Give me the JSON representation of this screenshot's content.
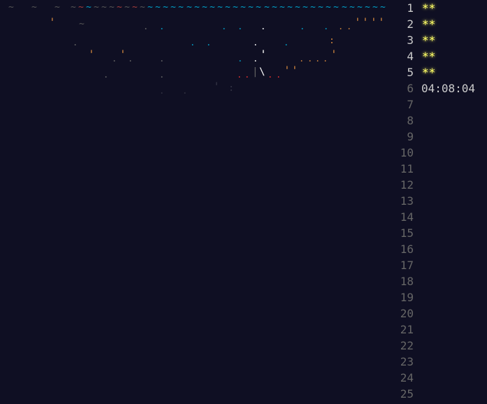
{
  "art": {
    "wave_row": "~  ~  ~ ~~~~~~~~~~~~~~~~~~~~~~~~~~~~~~~~~~~~~~~~~~~~~",
    "colors": {
      "background": "#0f0f23",
      "wave_dim": "#555555",
      "wave_red": "#a33c3c",
      "wave_cyan": "#00a0c8",
      "tree_cyan": "#00a0c8",
      "tree_gray": "#666666",
      "sand": "#c8803c",
      "red": "#e03030",
      "white": "#ffffff"
    },
    "icons": [
      "tilde-wave-icon",
      "dot-glyph-icon",
      "apostrophe-glyph-icon",
      "backslash-glyph-icon",
      "pipe-glyph-icon",
      "colon-glyph-icon"
    ]
  },
  "calendar": {
    "days": [
      {
        "label": "1",
        "stars": "**"
      },
      {
        "label": "2",
        "stars": "**"
      },
      {
        "label": "3",
        "stars": "**"
      },
      {
        "label": "4",
        "stars": "**"
      },
      {
        "label": "5",
        "stars": "**"
      },
      {
        "label": "6",
        "timer": "04:08:04"
      },
      {
        "label": "7"
      },
      {
        "label": "8"
      },
      {
        "label": "9"
      },
      {
        "label": "10"
      },
      {
        "label": "11"
      },
      {
        "label": "12"
      },
      {
        "label": "13"
      },
      {
        "label": "14"
      },
      {
        "label": "15"
      },
      {
        "label": "16"
      },
      {
        "label": "17"
      },
      {
        "label": "18"
      },
      {
        "label": "19"
      },
      {
        "label": "20"
      },
      {
        "label": "21"
      },
      {
        "label": "22"
      },
      {
        "label": "23"
      },
      {
        "label": "24"
      },
      {
        "label": "25"
      }
    ]
  }
}
